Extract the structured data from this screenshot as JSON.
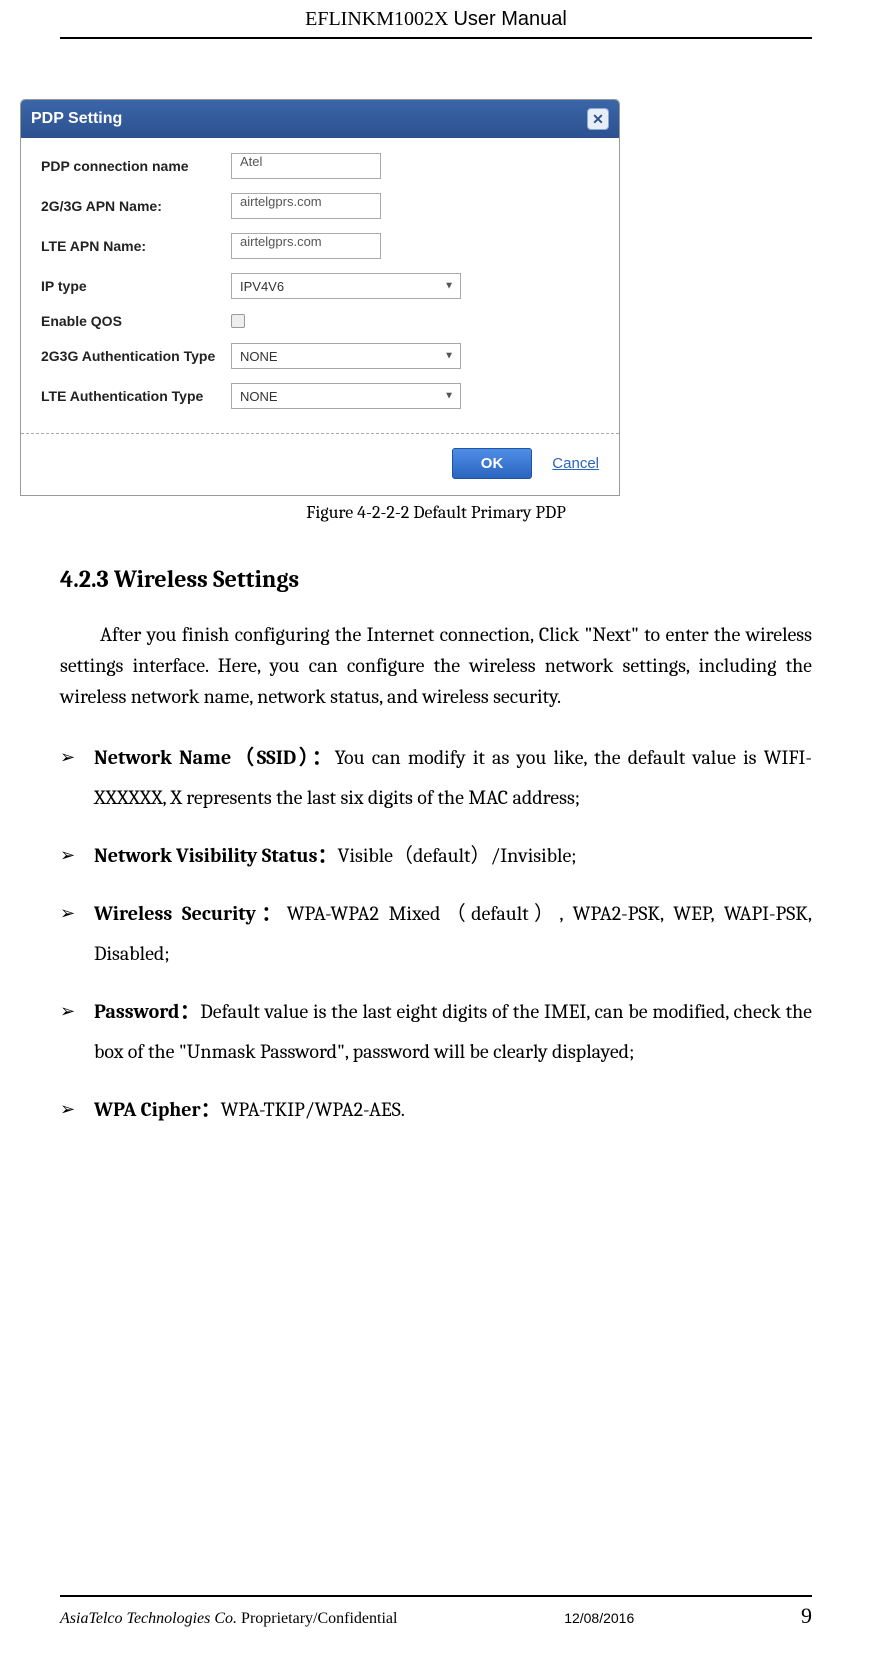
{
  "header": {
    "product": "EFLINKM1002X",
    "label": "User Manual"
  },
  "dialog": {
    "title": "PDP Setting",
    "close_glyph": "✕",
    "rows": {
      "pdp_name_label": "PDP connection name",
      "pdp_name_value": "Atel",
      "apn2g3g_label": "2G/3G APN Name:",
      "apn2g3g_value": "airtelgprs.com",
      "lteapn_label": "LTE APN Name:",
      "lteapn_value": "airtelgprs.com",
      "iptype_label": "IP type",
      "iptype_value": "IPV4V6",
      "qos_label": "Enable QOS",
      "auth2g3g_label": "2G3G Authentication Type",
      "auth2g3g_value": "NONE",
      "lteauth_label": "LTE Authentication Type",
      "lteauth_value": "NONE"
    },
    "footer": {
      "ok_label": "OK",
      "cancel_label": "Cancel"
    }
  },
  "figure_caption": "Figure 4-2-2-2 Default Primary PDP",
  "section_heading": "4.2.3 Wireless Settings",
  "paragraph": "After you finish configuring the Internet connection, Click \"Next\" to enter the wireless settings interface. Here, you can configure the wireless network settings, including the wireless network name, network status, and wireless security.",
  "bullets": [
    {
      "bold": "Network Name（SSID）：",
      "rest": "You can modify it as you like, the default value is WIFI-XXXXXX, X represents the last six digits of the MAC address;"
    },
    {
      "bold": "Network Visibility Status：",
      "rest": "Visible（default）/Invisible;"
    },
    {
      "bold": "Wireless Security：",
      "rest": "WPA-WPA2 Mixed（default）, WPA2-PSK, WEP, WAPI-PSK, Disabled;"
    },
    {
      "bold": "Password：",
      "rest": "Default value is the last eight digits of the IMEI, can be modified, check the box of the \"Unmask Password\", password will be clearly displayed;"
    },
    {
      "bold": "WPA Cipher：",
      "rest": "WPA-TKIP/WPA2-AES."
    }
  ],
  "bullet_marker": "➢",
  "select_caret": "▼",
  "footer": {
    "company_italic": "AsiaTelco Technologies Co.",
    "company_suffix": " Proprietary/Confidential",
    "date": "12/08/2016",
    "page": "9"
  }
}
